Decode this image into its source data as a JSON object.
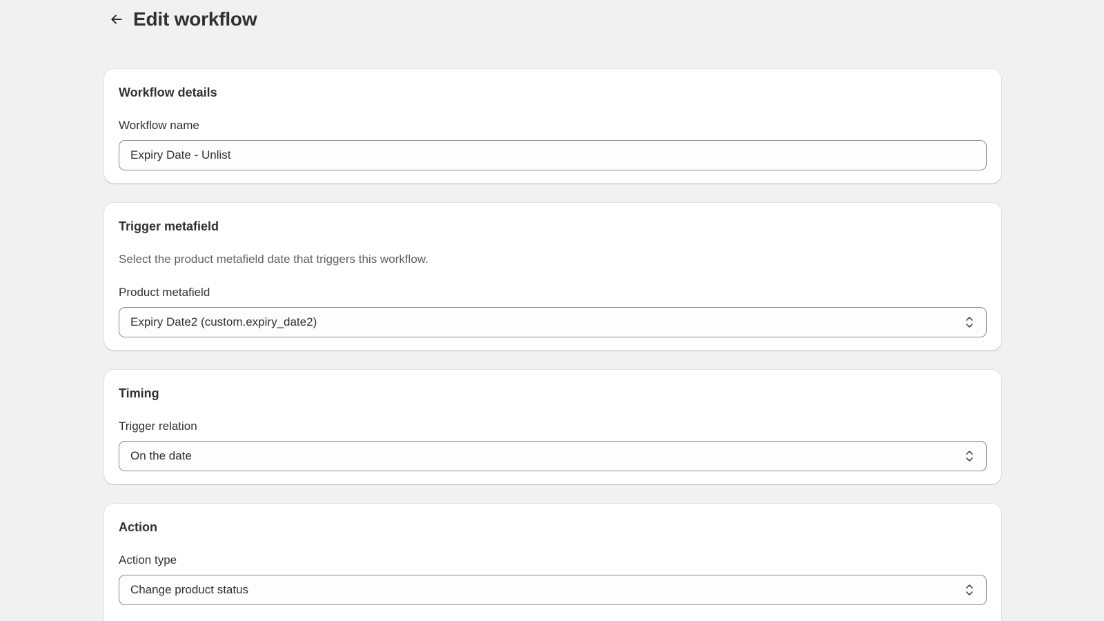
{
  "header": {
    "title": "Edit workflow",
    "back_icon": "arrow-left-icon"
  },
  "workflow_details": {
    "title": "Workflow details",
    "name_label": "Workflow name",
    "name_value": "Expiry Date - Unlist"
  },
  "trigger_metafield": {
    "title": "Trigger metafield",
    "description": "Select the product metafield date that triggers this workflow.",
    "metafield_label": "Product metafield",
    "metafield_value": "Expiry Date2 (custom.expiry_date2)"
  },
  "timing": {
    "title": "Timing",
    "relation_label": "Trigger relation",
    "relation_value": "On the date"
  },
  "action": {
    "title": "Action",
    "type_label": "Action type",
    "type_value": "Change product status"
  },
  "colors": {
    "background": "#f1f1f1",
    "card": "#ffffff",
    "text": "#303030",
    "muted_text": "#616161",
    "input_border": "#8a8a8a"
  }
}
